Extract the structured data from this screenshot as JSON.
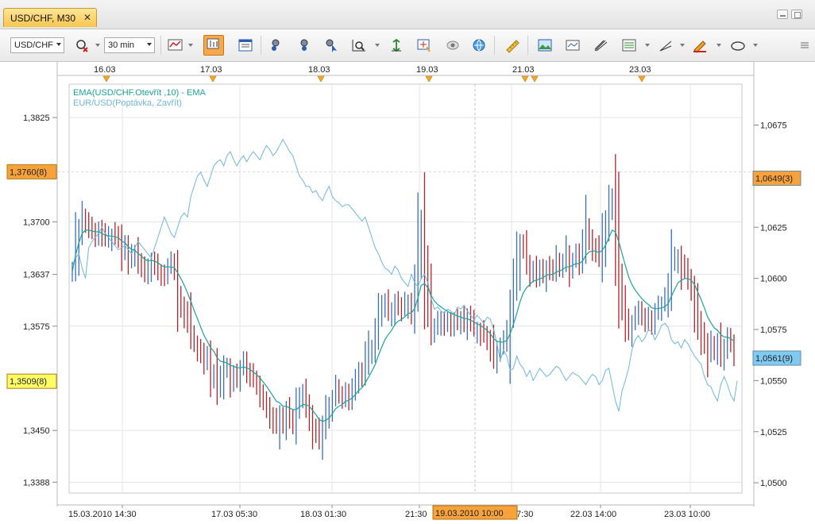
{
  "window": {
    "tab_title": "USD/CHF, M30",
    "tab_close": "✕"
  },
  "toolbar": {
    "instrument": "USD/CHF",
    "period": "30 min",
    "icons": [
      "chart-type-icon",
      "bar-chart-icon",
      "table-icon",
      "indicator-add-icon",
      "indicator-remove-icon",
      "cursor-icon",
      "zoom-icon",
      "fit-icon",
      "crosshair-icon",
      "eye-icon",
      "globe-icon",
      "ruler-icon",
      "picture-icon",
      "template-icon",
      "fork-icon",
      "layers-icon",
      "trendline-icon",
      "pencil-icon",
      "ellipse-icon",
      "menu-icon"
    ]
  },
  "colors": {
    "up": "#3a6fb6",
    "down": "#b0242c",
    "ema": "#1aa39a",
    "eurusd": "#6fb6e0",
    "left_highlight": "#f7a23a",
    "left_highlight2": "#ffff66",
    "right_highlight": "#f7a23a",
    "right_highlight2": "#7fcaf0"
  },
  "chart_data": {
    "type": "line",
    "title": "",
    "legend": [
      "EMA(USD/CHF.Otevřít ,10) - EMA",
      "EUR/USD(Poptávka, Zavřít)"
    ],
    "left_axis": {
      "ticks": [
        "1,3825",
        "1,3700",
        "1,3637",
        "1,3575",
        "1,3450",
        "1,3388"
      ],
      "tick_values": [
        1.3825,
        1.37,
        1.3637,
        1.3575,
        1.345,
        1.3388
      ],
      "range": [
        1.3375,
        1.3865
      ],
      "highlight_labels": [
        {
          "text": "1,3760(8)",
          "value": 1.376,
          "style": "orange"
        },
        {
          "text": "1,3509(8)",
          "value": 1.3509,
          "style": "yellow"
        }
      ]
    },
    "right_axis": {
      "ticks": [
        "1,0675",
        "1,0625",
        "1,0600",
        "1,0575",
        "1,0550",
        "1,0525",
        "1,0500"
      ],
      "tick_values": [
        1.0675,
        1.0625,
        1.06,
        1.0575,
        1.055,
        1.0525,
        1.05
      ],
      "range": [
        1.0495,
        1.0695
      ],
      "highlight_labels": [
        {
          "text": "1,0649(3)",
          "value": 1.0649,
          "style": "orange"
        },
        {
          "text": "1,0561(9)",
          "value": 1.0561,
          "style": "blue"
        }
      ]
    },
    "top_axis": [
      "16.03",
      "17.03",
      "18.03",
      "19.03",
      "21.03",
      "23.03"
    ],
    "bottom_axis": [
      "15.03.2010 14:30",
      "17.03 05:30",
      "18.03 01:30",
      "21:30",
      "7:30",
      "22.03 14:00",
      "23.03 10:00"
    ],
    "crosshair_label": "19.03.2010 10:00",
    "candles_close": [
      1.3645,
      1.367,
      1.369,
      1.3705,
      1.37,
      1.3693,
      1.369,
      1.3685,
      1.369,
      1.3682,
      1.3678,
      1.368,
      1.3683,
      1.368,
      1.3678,
      1.3662,
      1.3668,
      1.3655,
      1.366,
      1.3662,
      1.365,
      1.3645,
      1.3638,
      1.3645,
      1.3654,
      1.365,
      1.3642,
      1.364,
      1.3638,
      1.3645,
      1.3648,
      1.364,
      1.361,
      1.36,
      1.359,
      1.358,
      1.356,
      1.3552,
      1.3545,
      1.354,
      1.353,
      1.3535,
      1.3515,
      1.352,
      1.35,
      1.351,
      1.3525,
      1.3525,
      1.3512,
      1.352,
      1.3515,
      1.3525,
      1.353,
      1.352,
      1.3515,
      1.351,
      1.3505,
      1.3495,
      1.3488,
      1.348,
      1.347,
      1.3462,
      1.3455,
      1.347,
      1.3462,
      1.3475,
      1.3465,
      1.346,
      1.348,
      1.349,
      1.3495,
      1.3482,
      1.347,
      1.3455,
      1.345,
      1.344,
      1.3455,
      1.347,
      1.348,
      1.349,
      1.35,
      1.3495,
      1.3492,
      1.3498,
      1.349,
      1.35,
      1.351,
      1.352,
      1.3515,
      1.353,
      1.3545,
      1.355,
      1.3565,
      1.3585,
      1.3595,
      1.36,
      1.359,
      1.3595,
      1.3605,
      1.36,
      1.3595,
      1.36,
      1.3605,
      1.3595,
      1.362,
      1.3665,
      1.369,
      1.363,
      1.36,
      1.357,
      1.3575,
      1.358,
      1.3585,
      1.358,
      1.358,
      1.3575,
      1.358,
      1.3578,
      1.3582,
      1.3575,
      1.3585,
      1.3578,
      1.357,
      1.3572,
      1.3568,
      1.3565,
      1.356,
      1.355,
      1.3535,
      1.3545,
      1.355,
      1.3555,
      1.3565,
      1.36,
      1.3625,
      1.365,
      1.367,
      1.3665,
      1.365,
      1.364,
      1.3642,
      1.3632,
      1.364,
      1.3635,
      1.3645,
      1.364,
      1.3638,
      1.365,
      1.3645,
      1.365,
      1.3662,
      1.3648,
      1.3655,
      1.366,
      1.365,
      1.3665,
      1.369,
      1.368,
      1.367,
      1.3665,
      1.3655,
      1.368,
      1.37,
      1.372,
      1.373,
      1.368,
      1.362,
      1.36,
      1.358,
      1.357,
      1.358,
      1.3585,
      1.359,
      1.3585,
      1.358,
      1.3585,
      1.358,
      1.359,
      1.3595,
      1.36,
      1.3605,
      1.362,
      1.365,
      1.3655,
      1.366,
      1.3645,
      1.364,
      1.363,
      1.362,
      1.36,
      1.358,
      1.3565,
      1.3555,
      1.354,
      1.355,
      1.3545,
      1.3555,
      1.354,
      1.355,
      1.356,
      1.3555,
      1.3545
    ],
    "ema_values": [
      1.364,
      1.366,
      1.3675,
      1.3686,
      1.369,
      1.369,
      1.3689,
      1.3688,
      1.3688,
      1.3686,
      1.3684,
      1.3683,
      1.3683,
      1.3682,
      1.3681,
      1.3677,
      1.3675,
      1.367,
      1.3667,
      1.3666,
      1.3662,
      1.3659,
      1.3655,
      1.3653,
      1.3654,
      1.3653,
      1.3651,
      1.3648,
      1.3646,
      1.3646,
      1.3646,
      1.3645,
      1.3639,
      1.3632,
      1.3624,
      1.3615,
      1.3605,
      1.3594,
      1.3584,
      1.3574,
      1.3564,
      1.3557,
      1.3549,
      1.3545,
      1.3537,
      1.3533,
      1.3532,
      1.3531,
      1.3528,
      1.3527,
      1.3525,
      1.3525,
      1.3526,
      1.3525,
      1.3523,
      1.352,
      1.3517,
      1.3513,
      1.3508,
      1.3503,
      1.3497,
      1.3491,
      1.3485,
      1.3483,
      1.3479,
      1.3479,
      1.3477,
      1.3475,
      1.3475,
      1.3478,
      1.3481,
      1.3481,
      1.3479,
      1.3474,
      1.3469,
      1.3463,
      1.3461,
      1.3462,
      1.3465,
      1.347,
      1.3476,
      1.3479,
      1.3481,
      1.3485,
      1.3486,
      1.3489,
      1.3493,
      1.3498,
      1.3501,
      1.3507,
      1.3514,
      1.3521,
      1.3529,
      1.354,
      1.355,
      1.3559,
      1.3565,
      1.357,
      1.3577,
      1.3581,
      1.3583,
      1.3586,
      1.359,
      1.3591,
      1.3596,
      1.3609,
      1.3624,
      1.3626,
      1.3621,
      1.3612,
      1.3605,
      1.3601,
      1.3598,
      1.3595,
      1.3593,
      1.359,
      1.3589,
      1.3587,
      1.3586,
      1.3584,
      1.3584,
      1.3582,
      1.358,
      1.3578,
      1.3576,
      1.3573,
      1.357,
      1.3566,
      1.356,
      1.3557,
      1.3556,
      1.3556,
      1.3558,
      1.3566,
      1.3577,
      1.359,
      1.3604,
      1.3615,
      1.3621,
      1.3625,
      1.3629,
      1.363,
      1.3632,
      1.3633,
      1.3636,
      1.3637,
      1.3637,
      1.364,
      1.3641,
      1.3643,
      1.3646,
      1.3646,
      1.3648,
      1.365,
      1.365,
      1.3653,
      1.366,
      1.3664,
      1.3665,
      1.3665,
      1.3663,
      1.3666,
      1.3672,
      1.3681,
      1.369,
      1.3688,
      1.3676,
      1.3662,
      1.3648,
      1.3634,
      1.3625,
      1.3618,
      1.3613,
      1.3608,
      1.3604,
      1.3601,
      1.3597,
      1.3596,
      1.3596,
      1.3597,
      1.3598,
      1.3602,
      1.3611,
      1.3619,
      1.3627,
      1.363,
      1.3632,
      1.3632,
      1.363,
      1.3625,
      1.3616,
      1.3607,
      1.3597,
      1.3586,
      1.3579,
      1.3573,
      1.357,
      1.3565,
      1.3562,
      1.3562,
      1.356,
      1.3557
    ],
    "eurusd_values": [
      1.0606,
      1.061,
      1.0612,
      1.0605,
      1.06,
      1.0615,
      1.0618,
      1.062,
      1.0622,
      1.0625,
      1.0622,
      1.062,
      1.0618,
      1.0616,
      1.0614,
      1.0615,
      1.0616,
      1.0614,
      1.0612,
      1.0615,
      1.0618,
      1.0616,
      1.0614,
      1.0612,
      1.061,
      1.0615,
      1.062,
      1.0625,
      1.063,
      1.0626,
      1.0622,
      1.062,
      1.0625,
      1.063,
      1.0632,
      1.063,
      1.064,
      1.0645,
      1.065,
      1.0652,
      1.0648,
      1.0645,
      1.065,
      1.0655,
      1.0657,
      1.0658,
      1.0655,
      1.066,
      1.0662,
      1.0658,
      1.0655,
      1.0658,
      1.066,
      1.0657,
      1.066,
      1.0662,
      1.066,
      1.0658,
      1.0662,
      1.0665,
      1.0663,
      1.066,
      1.0662,
      1.0665,
      1.0668,
      1.0665,
      1.0662,
      1.066,
      1.0655,
      1.065,
      1.0648,
      1.0645,
      1.0645,
      1.0642,
      1.0643,
      1.064,
      1.0638,
      1.0642,
      1.0645,
      1.064,
      1.0638,
      1.0637,
      1.0635,
      1.0636,
      1.0636,
      1.0634,
      1.0632,
      1.063,
      1.0628,
      1.063,
      1.0625,
      1.062,
      1.0615,
      1.0612,
      1.0608,
      1.0605,
      1.0604,
      1.0602,
      1.0606,
      1.0604,
      1.06,
      1.0598,
      1.0596,
      1.0602,
      1.0598,
      1.0596,
      1.06,
      1.0602,
      1.0598,
      1.059,
      1.0585,
      1.0586,
      1.0584,
      1.0583,
      1.0585,
      1.0584,
      1.0582,
      1.0586,
      1.0585,
      1.0587,
      1.0584,
      1.0582,
      1.058,
      1.0582,
      1.058,
      1.0578,
      1.0581,
      1.058,
      1.0575,
      1.0568,
      1.056,
      1.0565,
      1.0562,
      1.0555,
      1.0556,
      1.0562,
      1.0558,
      1.0556,
      1.0552,
      1.0555,
      1.055,
      1.0553,
      1.0556,
      1.0554,
      1.0552,
      1.0553,
      1.0555,
      1.0557,
      1.0556,
      1.0553,
      1.055,
      1.0552,
      1.0554,
      1.0553,
      1.0552,
      1.055,
      1.0548,
      1.0551,
      1.0553,
      1.0552,
      1.0548,
      1.055,
      1.0555,
      1.0556,
      1.0548,
      1.054,
      1.0535,
      1.0545,
      1.055,
      1.0556,
      1.0565,
      1.057,
      1.0572,
      1.0569,
      1.0571,
      1.0575,
      1.0574,
      1.057,
      1.0573,
      1.0577,
      1.0578,
      1.0576,
      1.057,
      1.0568,
      1.0569,
      1.0566,
      1.057,
      1.0568,
      1.0565,
      1.0562,
      1.056,
      1.0558,
      1.0552,
      1.0548,
      1.0547,
      1.0543,
      1.054,
      1.0548,
      1.0552,
      1.0548,
      1.0543,
      1.054,
      1.055
    ]
  }
}
